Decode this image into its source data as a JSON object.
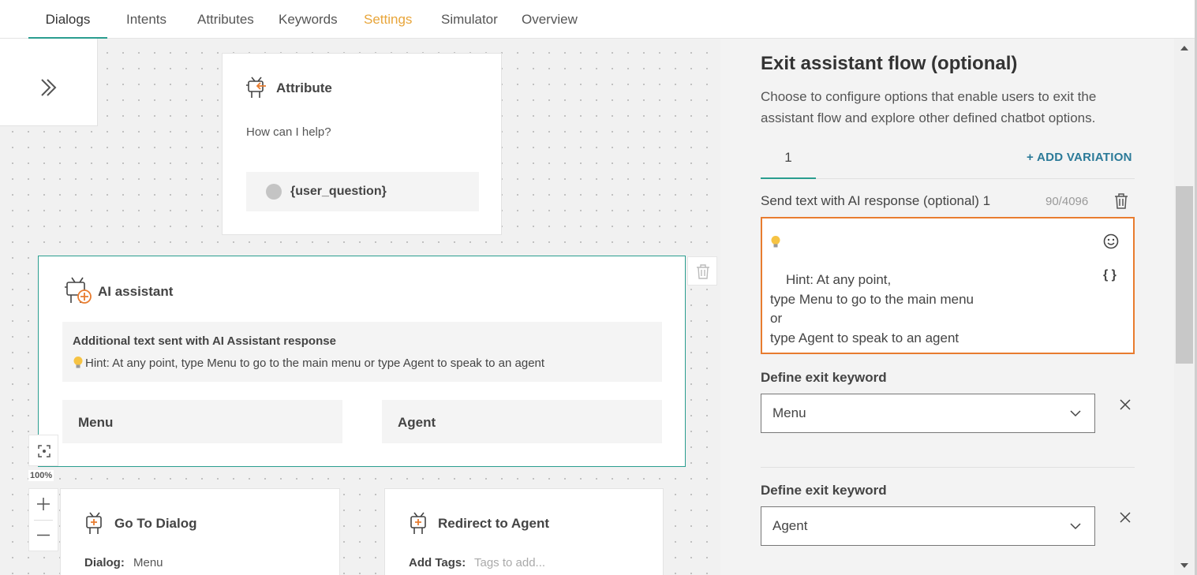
{
  "tabs": [
    {
      "label": "Dialogs"
    },
    {
      "label": "Intents"
    },
    {
      "label": "Attributes"
    },
    {
      "label": "Keywords"
    },
    {
      "label": "Settings"
    },
    {
      "label": "Simulator"
    },
    {
      "label": "Overview"
    }
  ],
  "canvas": {
    "zoom_level": "100%",
    "attribute_node": {
      "title": "Attribute",
      "prompt": "How can I help?",
      "variable": "{user_question}"
    },
    "ai_node": {
      "title": "AI assistant",
      "additional_label": "Additional text sent with AI Assistant response",
      "hint_text": "Hint: At any point, type Menu to go to the main menu or type Agent to speak to an agent",
      "buttons": [
        {
          "label": "Menu"
        },
        {
          "label": "Agent"
        }
      ]
    },
    "goto_node": {
      "title": "Go To Dialog",
      "dialog_label": "Dialog:",
      "dialog_value": "Menu"
    },
    "redirect_node": {
      "title": "Redirect to Agent",
      "tags_label": "Add Tags:",
      "tags_placeholder": "Tags to add..."
    }
  },
  "panel": {
    "title": "Exit assistant flow (optional)",
    "description": "Choose to configure options that enable users to exit the assistant flow and explore other defined chatbot options.",
    "variation_tab": "1",
    "add_variation": "+ ADD VARIATION",
    "send_text_label": "Send text with AI response (optional) 1",
    "char_count": "90/4096",
    "text_value": "Hint: At any point,\ntype Menu to go to the main menu\nor\ntype Agent to speak to an agent",
    "insert_variable_label": "{ }",
    "exit_keywords": [
      {
        "label": "Define exit keyword",
        "value": "Menu"
      },
      {
        "label": "Define exit keyword",
        "value": "Agent"
      }
    ]
  },
  "colors": {
    "accent_teal": "#2a9d8f",
    "settings_tab": "#e8a53a",
    "focus_orange": "#e87c2f",
    "link_blue": "#2b7a98"
  }
}
